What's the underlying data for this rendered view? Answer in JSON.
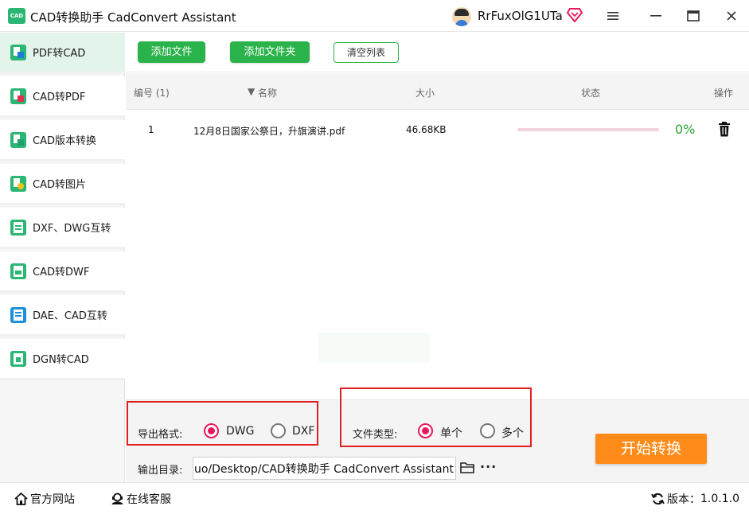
{
  "app": {
    "logo_text": "CAD",
    "title": "CAD转换助手 CadConvert Assistant",
    "username": "RrFuxOlG1UTa"
  },
  "colors": {
    "accent_green": "#2bb34b",
    "active_sidebar_bg": "#e3f5ea",
    "radio_selected": "#e6195a",
    "start_button": "#ff8c1a",
    "highlight_box": "#e02020",
    "progress_track": "#f3d4dc"
  },
  "sidebar": {
    "items": [
      {
        "label": "PDF转CAD",
        "icon": "pdf-to-cad-icon"
      },
      {
        "label": "CAD转PDF",
        "icon": "cad-to-pdf-icon"
      },
      {
        "label": "CAD版本转换",
        "icon": "cad-version-icon"
      },
      {
        "label": "CAD转图片",
        "icon": "cad-to-image-icon"
      },
      {
        "label": "DXF、DWG互转",
        "icon": "dxf-dwg-icon"
      },
      {
        "label": "CAD转DWF",
        "icon": "cad-to-dwf-icon"
      },
      {
        "label": "DAE、CAD互转",
        "icon": "dae-cad-icon"
      },
      {
        "label": "DGN转CAD",
        "icon": "dgn-to-cad-icon"
      }
    ]
  },
  "toolbar": {
    "add_file": "添加文件",
    "add_folder": "添加文件夹",
    "clear_list": "清空列表"
  },
  "table": {
    "headers": {
      "index": "编号 (1)",
      "name": "名称",
      "size": "大小",
      "status": "状态",
      "action": "操作"
    },
    "rows": [
      {
        "index": "1",
        "name": "12月8日国家公祭日，升旗演讲.pdf",
        "size": "46.68KB",
        "progress": 0,
        "percent_text": "0%"
      }
    ]
  },
  "options": {
    "export_format_label": "导出格式:",
    "format_dwg": "DWG",
    "format_dxf": "DXF",
    "selected_format": "DWG",
    "file_type_label": "文件类型:",
    "type_single": "单个",
    "type_multiple": "多个",
    "selected_type": "单个",
    "output_dir_label": "输出目录:",
    "output_dir_value": "C:/Users/guo/Desktop/CAD转换助手 CadConvert Assistant",
    "more": "···",
    "start_button": "开始转换"
  },
  "footer": {
    "website": "官方网站",
    "support": "在线客服",
    "version_label": "版本：",
    "version": "1.0.1.0"
  }
}
